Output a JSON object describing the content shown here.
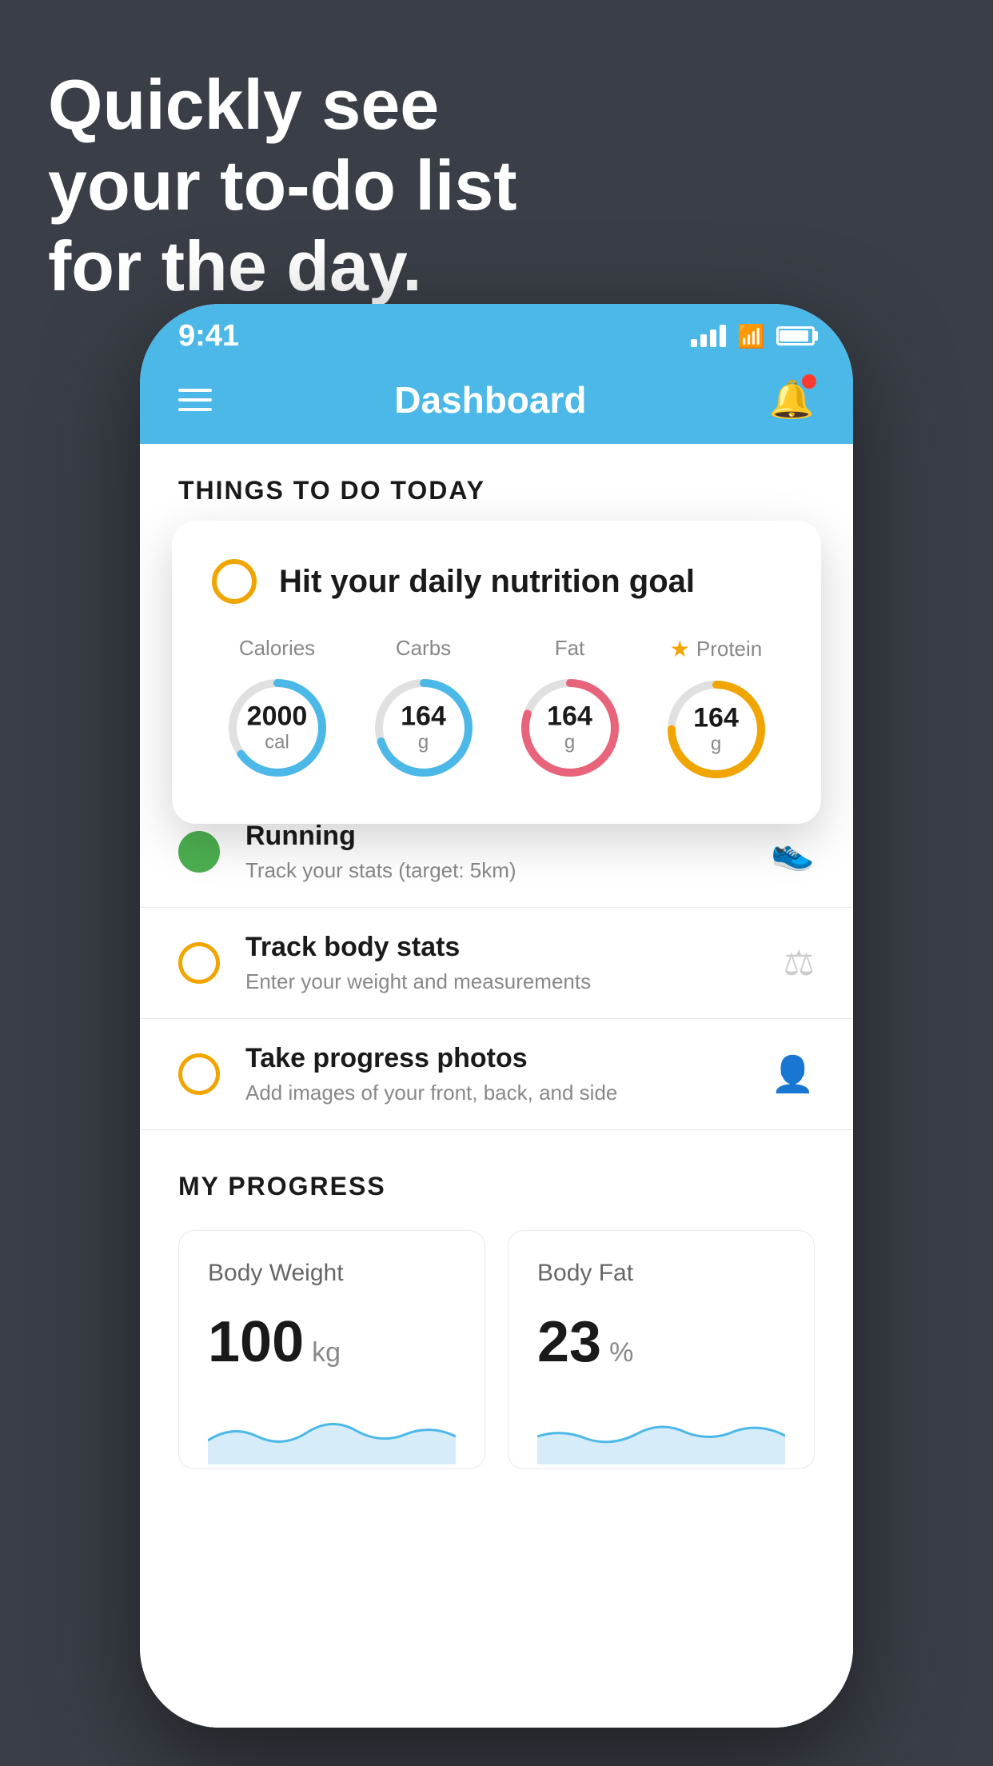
{
  "hero": {
    "line1": "Quickly see",
    "line2": "your to-do list",
    "line3": "for the day."
  },
  "status_bar": {
    "time": "9:41",
    "signal": "signal",
    "wifi": "wifi",
    "battery": "battery"
  },
  "nav": {
    "title": "Dashboard",
    "menu_label": "menu",
    "bell_label": "notifications"
  },
  "things_today": {
    "header": "THINGS TO DO TODAY",
    "nutrition_card": {
      "title": "Hit your daily nutrition goal",
      "macros": [
        {
          "label": "Calories",
          "value": "2000",
          "unit": "cal",
          "color": "#4bb8e8",
          "pct": 65
        },
        {
          "label": "Carbs",
          "value": "164",
          "unit": "g",
          "color": "#4bb8e8",
          "pct": 70
        },
        {
          "label": "Fat",
          "value": "164",
          "unit": "g",
          "color": "#e8647a",
          "pct": 80
        },
        {
          "label": "Protein",
          "value": "164",
          "unit": "g",
          "color": "#f0a500",
          "pct": 75,
          "starred": true
        }
      ]
    },
    "todo_items": [
      {
        "id": "running",
        "title": "Running",
        "subtitle": "Track your stats (target: 5km)",
        "checked": true,
        "check_color": "green",
        "icon": "👟"
      },
      {
        "id": "body-stats",
        "title": "Track body stats",
        "subtitle": "Enter your weight and measurements",
        "checked": false,
        "check_color": "orange",
        "icon": "⚖"
      },
      {
        "id": "progress-photos",
        "title": "Take progress photos",
        "subtitle": "Add images of your front, back, and side",
        "checked": false,
        "check_color": "orange",
        "icon": "👤"
      }
    ]
  },
  "my_progress": {
    "header": "MY PROGRESS",
    "cards": [
      {
        "title": "Body Weight",
        "value": "100",
        "unit": "kg"
      },
      {
        "title": "Body Fat",
        "value": "23",
        "unit": "%"
      }
    ]
  }
}
